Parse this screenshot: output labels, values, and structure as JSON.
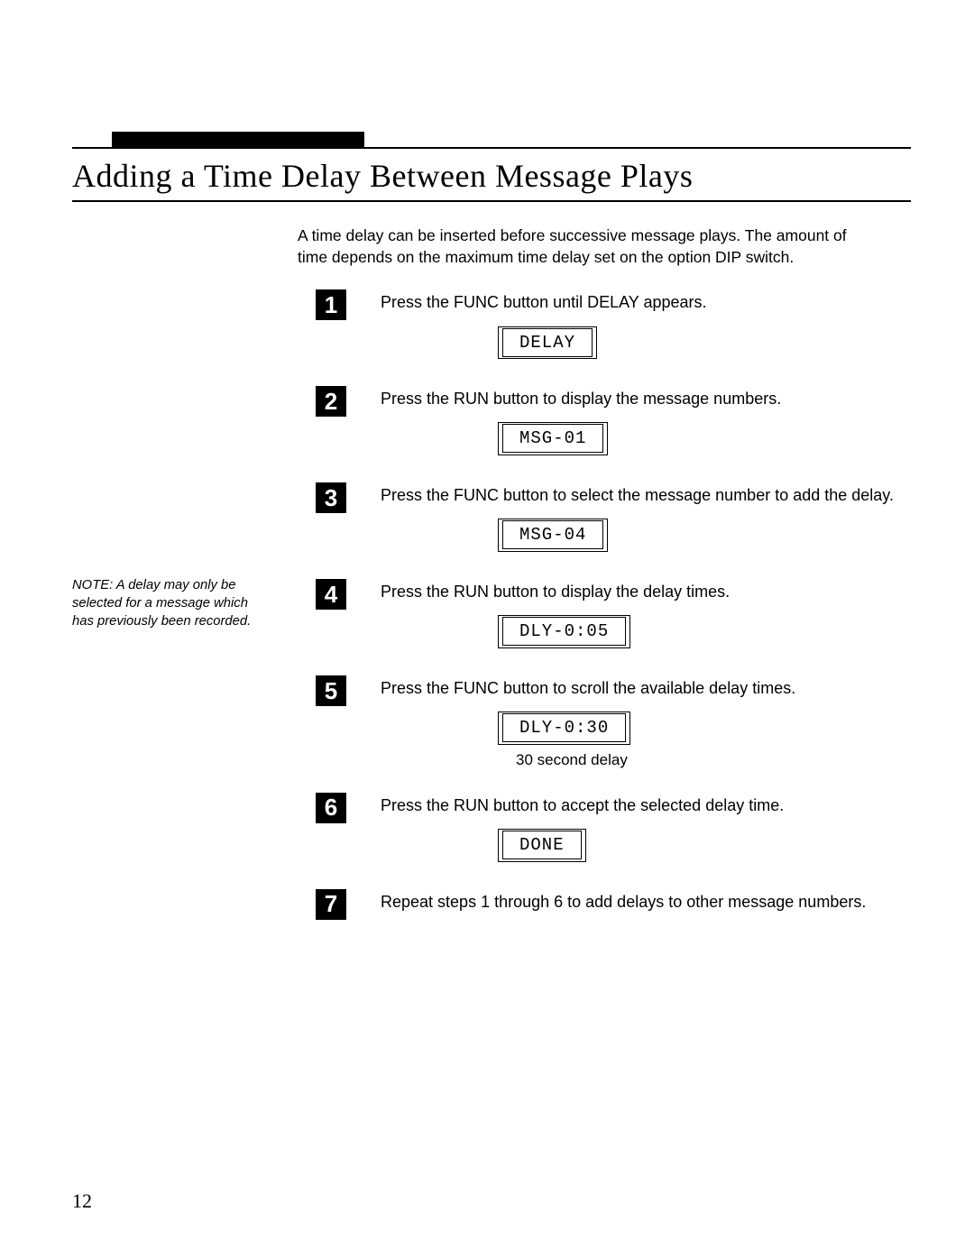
{
  "heading": "Adding a Time Delay Between Message Plays",
  "intro": "A time delay can be inserted before successive message plays. The amount of time depends on the maximum time delay set on the option DIP switch.",
  "side_note": "NOTE: A delay may only be selected for a message which has previously been recorded.",
  "steps": [
    {
      "num": "1",
      "text": "Press the FUNC button until DELAY appears.",
      "lcd": "DELAY"
    },
    {
      "num": "2",
      "text": "Press the RUN button to display the message numbers.",
      "lcd": "MSG-01"
    },
    {
      "num": "3",
      "text": "Press the FUNC button to select the message number to add the delay.",
      "lcd": "MSG-04"
    },
    {
      "num": "4",
      "text": "Press the RUN button to display the delay times.",
      "lcd": "DLY-0:05"
    },
    {
      "num": "5",
      "text": "Press the FUNC button to scroll the available delay times.",
      "lcd": "DLY-0:30",
      "caption": "30 second delay"
    },
    {
      "num": "6",
      "text": "Press the RUN button to accept the selected delay time.",
      "lcd": "DONE"
    },
    {
      "num": "7",
      "text": "Repeat steps 1 through 6 to add delays to other message numbers."
    }
  ],
  "page_number": "12"
}
